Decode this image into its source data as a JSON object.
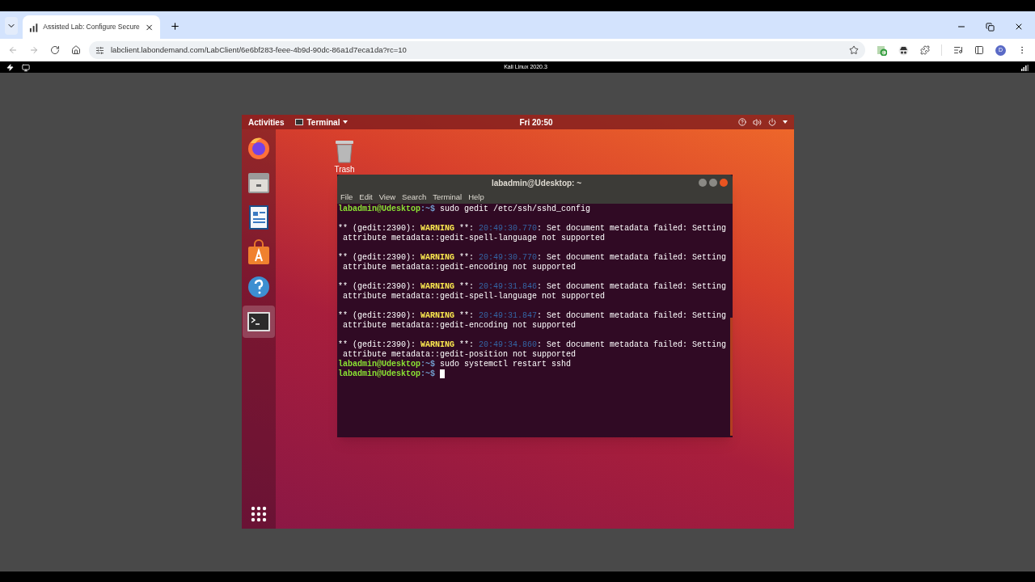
{
  "browser": {
    "tab": {
      "title": "Assisted Lab: Configure Secure",
      "selected": true
    },
    "address": "labclient.labondemand.com/LabClient/6e6bf283-feee-4b9d-90dc-86a1d7eca1da?rc=10",
    "profile_initial": "D"
  },
  "remote_bar": {
    "title": "Kali Linux 2020.3"
  },
  "ubuntu": {
    "top_bar": {
      "activities": "Activities",
      "app": "Terminal",
      "clock": "Fri 20:50"
    },
    "dock": [
      {
        "kind": "firefox",
        "selected": false
      },
      {
        "kind": "files",
        "selected": false
      },
      {
        "kind": "writer",
        "selected": false
      },
      {
        "kind": "software",
        "selected": false
      },
      {
        "kind": "help",
        "selected": false
      },
      {
        "kind": "terminal",
        "selected": true
      }
    ],
    "desktop_icons": [
      {
        "label": "Trash"
      }
    ],
    "terminal": {
      "title": "labadmin@Udesktop: ~",
      "menu": [
        "File",
        "Edit",
        "View",
        "Search",
        "Terminal",
        "Help"
      ],
      "lines": [
        {
          "kind": "prompt",
          "user": "labadmin@Udesktop",
          "path": ":~$",
          "command": "sudo gedit /etc/ssh/sshd_config"
        },
        {
          "kind": "blank"
        },
        {
          "kind": "warning",
          "prefix": "** (gedit:2390):",
          "tag": "WARNING",
          "after_tag": "**:",
          "time": "20:49:30.770",
          "message": ": Set document metadata failed: Setting"
        },
        {
          "kind": "text",
          "text": "attribute metadata::gedit-spell-language not supported"
        },
        {
          "kind": "blank"
        },
        {
          "kind": "warning",
          "prefix": "** (gedit:2390):",
          "tag": "WARNING",
          "after_tag": "**:",
          "time": "20:49:30.770",
          "message": ": Set document metadata failed: Setting"
        },
        {
          "kind": "text",
          "text": "attribute metadata::gedit-encoding not supported"
        },
        {
          "kind": "blank"
        },
        {
          "kind": "warning",
          "prefix": "** (gedit:2390):",
          "tag": "WARNING",
          "after_tag": "**:",
          "time": "20:49:31.846",
          "message": ": Set document metadata failed: Setting"
        },
        {
          "kind": "text",
          "text": "attribute metadata::gedit-spell-language not supported"
        },
        {
          "kind": "blank"
        },
        {
          "kind": "warning",
          "prefix": "** (gedit:2390):",
          "tag": "WARNING",
          "after_tag": "**:",
          "time": "20:49:31.847",
          "message": ": Set document metadata failed: Setting"
        },
        {
          "kind": "text",
          "text": "attribute metadata::gedit-encoding not supported"
        },
        {
          "kind": "blank"
        },
        {
          "kind": "warning",
          "prefix": "** (gedit:2390):",
          "tag": "WARNING",
          "after_tag": "**:",
          "time": "20:49:34.860",
          "message": ": Set document metadata failed: Setting"
        },
        {
          "kind": "text",
          "text": "attribute metadata::gedit-position not supported"
        },
        {
          "kind": "prompt",
          "user": "labadmin@Udesktop",
          "path": ":~$",
          "command": "sudo systemctl restart sshd"
        },
        {
          "kind": "prompt",
          "user": "labadmin@Udesktop",
          "path": ":~$",
          "cursor": true
        }
      ]
    }
  }
}
